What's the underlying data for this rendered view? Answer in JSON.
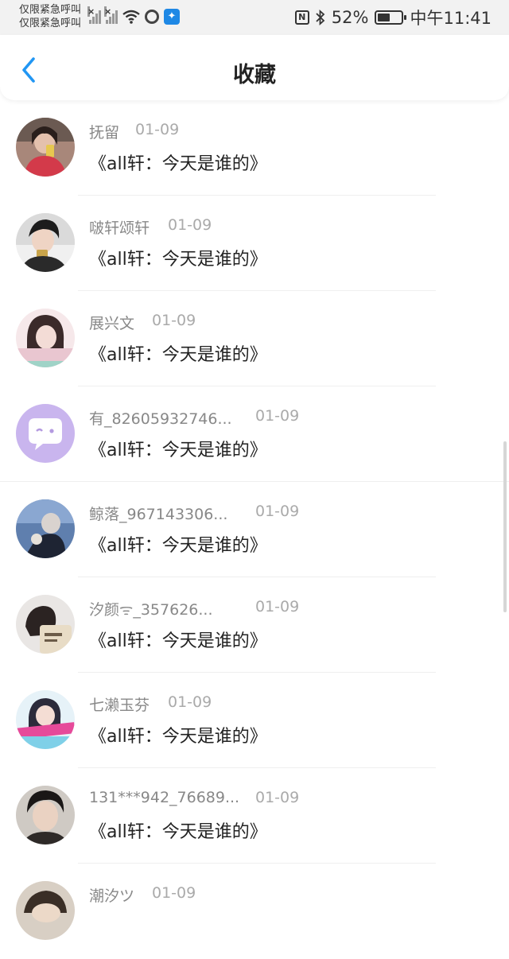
{
  "status_bar": {
    "carrier_line1": "仅限紧急呼叫",
    "carrier_line2": "仅限紧急呼叫",
    "battery": "52%",
    "time": "中午11:41",
    "battery_level": 0.52
  },
  "header": {
    "title": "收藏",
    "back_icon": "chevron-left-icon",
    "accent_color": "#2196f3"
  },
  "favorites": [
    {
      "name": "抚留",
      "date": "01-09",
      "title": "《all轩：今天是谁的》"
    },
    {
      "name": "啵轩颂轩",
      "date": "01-09",
      "title": "《all轩：今天是谁的》"
    },
    {
      "name": "展兴文",
      "date": "01-09",
      "title": "《all轩：今天是谁的》"
    },
    {
      "name": "有_82605932746...",
      "date": "01-09",
      "title": "《all轩：今天是谁的》"
    },
    {
      "name": "鲸落_967143306...",
      "date": "01-09",
      "title": "《all轩：今天是谁的》"
    },
    {
      "name": "汐颜ᯤ_357626...",
      "date": "01-09",
      "title": "《all轩：今天是谁的》"
    },
    {
      "name": "七濑玉芬",
      "date": "01-09",
      "title": "《all轩：今天是谁的》"
    },
    {
      "name": "131***942_76689...",
      "date": "01-09",
      "title": "《all轩：今天是谁的》"
    },
    {
      "name": "潮汐ツ",
      "date": "01-09",
      "title": ""
    }
  ]
}
